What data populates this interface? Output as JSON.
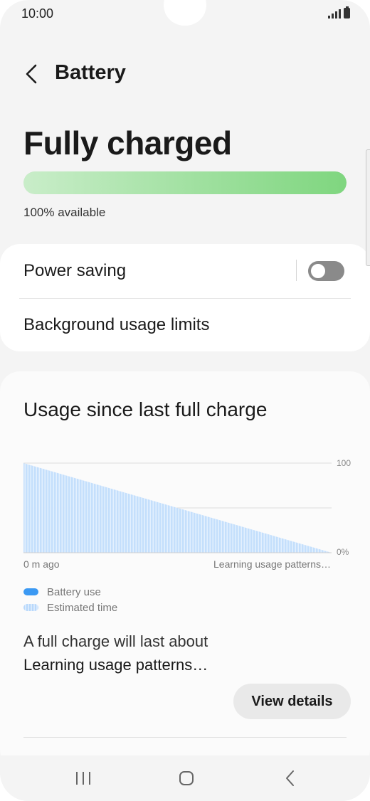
{
  "status_bar": {
    "time": "10:00"
  },
  "header": {
    "title": "Battery",
    "back_icon": "chevron-left-icon"
  },
  "battery": {
    "status": "Fully charged",
    "level_percent": 100,
    "available_text": "100% available",
    "bar_color": "#8fdb8f"
  },
  "settings": {
    "power_saving": {
      "label": "Power saving",
      "enabled": false
    },
    "background_limits": {
      "label": "Background usage limits"
    }
  },
  "usage": {
    "title": "Usage since last full charge",
    "y_top_label": "100",
    "y_bottom_label": "0%",
    "x_left_label": "0 m ago",
    "x_right_label": "Learning usage patterns…",
    "legend": {
      "battery_use": "Battery use",
      "estimated_time": "Estimated time"
    },
    "full_charge_label": "A full charge will last about",
    "full_charge_value": "Learning usage patterns…",
    "details_button": "View details"
  },
  "colors": {
    "battery_use": "#3b99f3",
    "estimated": "#c4dffc"
  },
  "nav": {
    "recents_icon": "recents-icon",
    "home_icon": "home-icon",
    "back_icon": "back-icon"
  }
}
